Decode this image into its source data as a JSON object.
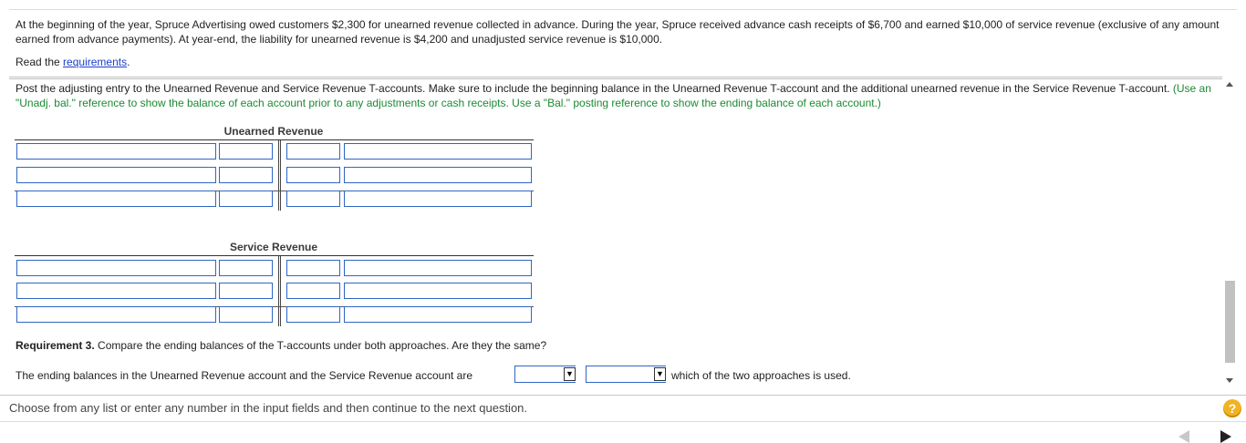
{
  "problem": {
    "intro": "At the beginning of the year, Spruce Advertising owed customers $2,300 for unearned revenue collected in advance. During the year, Spruce received advance cash receipts of $6,700 and earned $10,000 of service revenue (exclusive of any amount earned from advance payments). At year-end, the liability for unearned revenue is $4,200 and unadjusted service revenue is $10,000.",
    "read_prefix": "Read the ",
    "requirements_link": "requirements",
    "read_suffix": "."
  },
  "instructions": {
    "main": "Post the adjusting entry to the Unearned Revenue and Service Revenue T-accounts. Make sure to include the beginning balance in the Unearned Revenue T-account and the additional unearned revenue in the Service Revenue T-account. ",
    "hint": "(Use an \"Unadj. bal.\" reference to show the balance of each account prior to any adjustments or cash receipts. Use a \"Bal.\" posting reference to show the ending balance of each account.)"
  },
  "t_accounts": [
    {
      "title": "Unearned Revenue",
      "rows": [
        [
          "",
          "",
          "",
          ""
        ],
        [
          "",
          "",
          "",
          ""
        ],
        [
          "",
          "",
          "",
          ""
        ]
      ]
    },
    {
      "title": "Service Revenue",
      "rows": [
        [
          "",
          "",
          "",
          ""
        ],
        [
          "",
          "",
          "",
          ""
        ],
        [
          "",
          "",
          "",
          ""
        ]
      ]
    }
  ],
  "requirement3": {
    "label": "Requirement 3.",
    "question": " Compare the ending balances of the T-accounts under both approaches. Are they the same?",
    "answer_prefix": "The ending balances in the Unearned Revenue account and the Service Revenue account are",
    "dropdown1_value": "",
    "dropdown2_value": "",
    "answer_suffix": "which of the two approaches is used."
  },
  "footer": {
    "instruction": "Choose from any list or enter any number in the input fields and then continue to the next question.",
    "help_label": "?"
  },
  "icons": {
    "dropdown_arrow": "▼"
  }
}
